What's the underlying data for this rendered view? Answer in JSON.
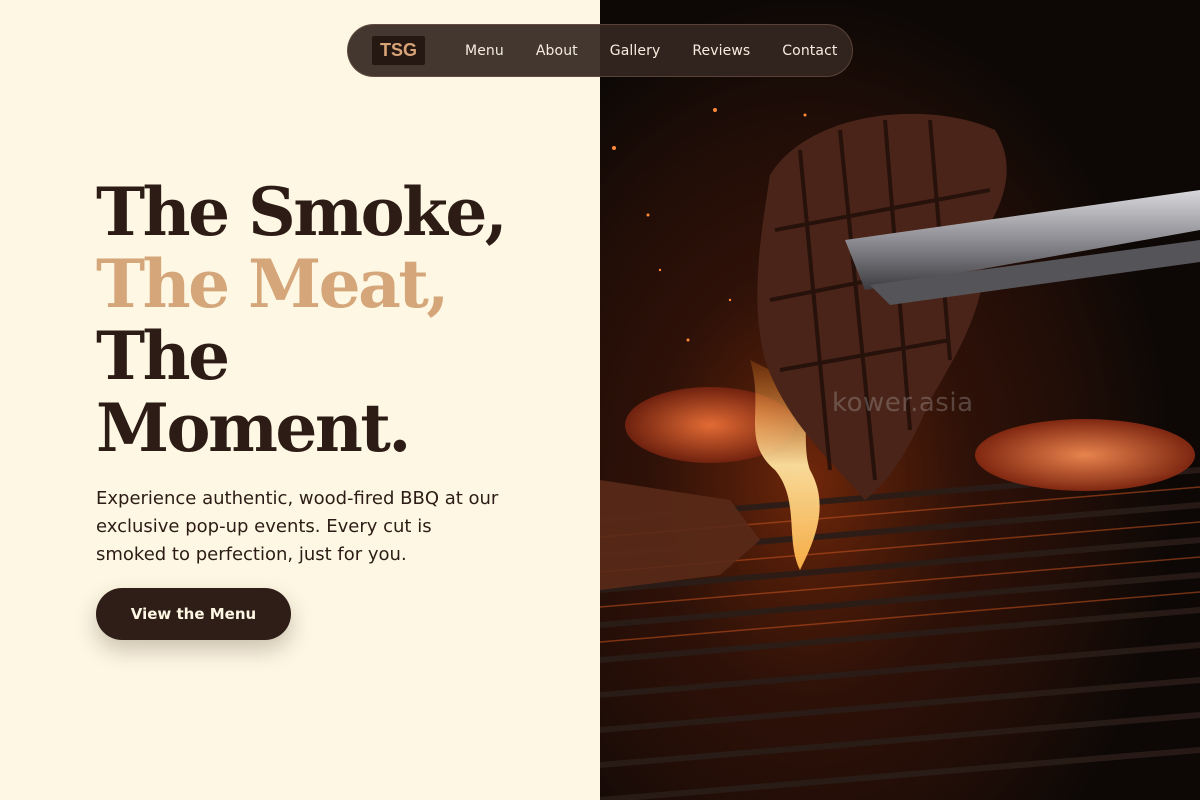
{
  "nav": {
    "logo": "TSG",
    "links": [
      "Menu",
      "About",
      "Gallery",
      "Reviews",
      "Contact"
    ]
  },
  "hero": {
    "headline": {
      "line1": "The Smoke,",
      "line2": "The Meat,",
      "line3": "The",
      "line4": "Moment."
    },
    "subtext": "Experience authentic, wood-fired BBQ at our exclusive pop-up events. Every cut is smoked to perfection, just for you.",
    "cta_label": "View the Menu"
  },
  "photo": {
    "watermark": "kower.asia",
    "icon": "grilling-steak-photo"
  },
  "colors": {
    "background": "#fdf7e3",
    "text_dark": "#2c1c15",
    "accent": "#d4a67a",
    "button": "#2e1e17"
  }
}
